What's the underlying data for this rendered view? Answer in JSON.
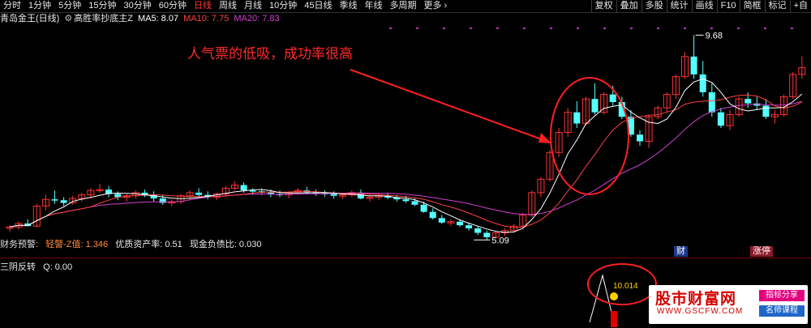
{
  "toolbar": {
    "periods": [
      "分时",
      "1分钟",
      "5分钟",
      "15分钟",
      "30分钟",
      "60分钟",
      "日线",
      "周线",
      "月线",
      "10分钟",
      "45日线",
      "季线",
      "年线",
      "多周期",
      "更多 ›"
    ],
    "active_period": "日线",
    "tools": [
      "复权",
      "叠加",
      "多股",
      "统计",
      "画线",
      "F10",
      "简框",
      "标记",
      "+自"
    ]
  },
  "indicator_line": {
    "stock": "青岛金王(日线)",
    "formula": "高胜率抄底主Z",
    "ma5": "MA5: 8.07",
    "ma10": "MA10: 7.75",
    "ma20": "MA20: 7.83",
    "ma5_color": "#ffffff",
    "ma10_color": "#ff4040",
    "ma20_color": "#d040d0"
  },
  "annotation": "人气票的低吸，成功率很高",
  "price_labels": {
    "high": "9.68",
    "low": "5.09"
  },
  "financial_row": {
    "title": "财务预警:",
    "warning": "轻警-Z值: 1.346",
    "quality": "优质资产率: 0.51",
    "cash": "现金负债比: 0.030"
  },
  "tags": {
    "cai": "财",
    "zhangting": "涨停"
  },
  "sub_panel": {
    "title": "三阴反转",
    "q": "Q: 0.00",
    "signal_value": "10.014"
  },
  "watermark": {
    "main": "股市财富网",
    "url": "WWW.GSCFW.COM",
    "tag1": "指标分享",
    "tag2": "名师课程"
  },
  "colors": {
    "up": "#ff3232",
    "down": "#54ffff",
    "ma5": "#ffffff",
    "ma10": "#ff4040",
    "ma20": "#d040d0"
  },
  "chart_data": {
    "type": "candlestick",
    "candles": [
      [
        5.35,
        5.42,
        5.28,
        5.38
      ],
      [
        5.38,
        5.5,
        5.32,
        5.46
      ],
      [
        5.46,
        5.55,
        5.4,
        5.4
      ],
      [
        5.4,
        5.9,
        5.38,
        5.85
      ],
      [
        5.85,
        6.1,
        5.75,
        6.0
      ],
      [
        6.0,
        6.2,
        5.9,
        5.98
      ],
      [
        5.98,
        6.05,
        5.85,
        5.92
      ],
      [
        5.92,
        6.08,
        5.88,
        6.02
      ],
      [
        6.02,
        6.15,
        5.95,
        6.1
      ],
      [
        6.1,
        6.25,
        6.02,
        6.2
      ],
      [
        6.2,
        6.35,
        6.15,
        6.22
      ],
      [
        6.22,
        6.3,
        6.05,
        6.12
      ],
      [
        6.12,
        6.18,
        5.98,
        6.05
      ],
      [
        6.05,
        6.12,
        5.95,
        6.08
      ],
      [
        6.08,
        6.2,
        6.02,
        6.15
      ],
      [
        6.15,
        6.22,
        6.05,
        6.1
      ],
      [
        6.1,
        6.18,
        5.95,
        6.02
      ],
      [
        6.02,
        6.1,
        5.88,
        5.92
      ],
      [
        5.92,
        6.0,
        5.85,
        5.95
      ],
      [
        5.95,
        6.12,
        5.9,
        6.08
      ],
      [
        6.08,
        6.2,
        6.0,
        6.15
      ],
      [
        6.15,
        6.25,
        6.05,
        6.1
      ],
      [
        6.1,
        6.18,
        6.0,
        6.05
      ],
      [
        6.05,
        6.15,
        5.98,
        6.12
      ],
      [
        6.12,
        6.3,
        6.08,
        6.25
      ],
      [
        6.25,
        6.4,
        6.2,
        6.32
      ],
      [
        6.32,
        6.38,
        6.15,
        6.2
      ],
      [
        6.2,
        6.25,
        6.1,
        6.18
      ],
      [
        6.18,
        6.24,
        6.1,
        6.15
      ],
      [
        6.15,
        6.22,
        6.05,
        6.12
      ],
      [
        6.12,
        6.2,
        6.05,
        6.1
      ],
      [
        6.1,
        6.18,
        6.02,
        6.15
      ],
      [
        6.15,
        6.25,
        6.1,
        6.2
      ],
      [
        6.2,
        6.28,
        6.12,
        6.16
      ],
      [
        6.16,
        6.22,
        6.08,
        6.14
      ],
      [
        6.14,
        6.2,
        6.06,
        6.12
      ],
      [
        6.12,
        6.18,
        6.02,
        6.08
      ],
      [
        6.08,
        6.15,
        6.0,
        6.1
      ],
      [
        6.1,
        6.2,
        6.05,
        6.15
      ],
      [
        6.15,
        6.22,
        6.0,
        6.02
      ],
      [
        6.02,
        6.1,
        5.95,
        6.05
      ],
      [
        6.05,
        6.12,
        5.98,
        6.08
      ],
      [
        6.08,
        6.15,
        6.0,
        6.04
      ],
      [
        6.04,
        6.1,
        5.95,
        6.0
      ],
      [
        6.0,
        6.08,
        5.92,
        5.96
      ],
      [
        5.96,
        6.02,
        5.85,
        5.88
      ],
      [
        5.88,
        5.95,
        5.7,
        5.72
      ],
      [
        5.72,
        5.8,
        5.55,
        5.58
      ],
      [
        5.58,
        5.65,
        5.45,
        5.48
      ],
      [
        5.48,
        5.55,
        5.4,
        5.5
      ],
      [
        5.5,
        5.55,
        5.38,
        5.42
      ],
      [
        5.42,
        5.48,
        5.3,
        5.35
      ],
      [
        5.35,
        5.4,
        5.2,
        5.25
      ],
      [
        5.25,
        5.3,
        5.09,
        5.15
      ],
      [
        5.15,
        5.28,
        5.12,
        5.25
      ],
      [
        5.25,
        5.35,
        5.18,
        5.3
      ],
      [
        5.3,
        5.45,
        5.25,
        5.4
      ],
      [
        5.4,
        5.7,
        5.38,
        5.65
      ],
      [
        5.65,
        6.2,
        5.6,
        6.15
      ],
      [
        6.15,
        6.5,
        6.05,
        6.45
      ],
      [
        6.45,
        7.1,
        6.4,
        7.05
      ],
      [
        7.05,
        7.6,
        6.95,
        7.5
      ],
      [
        7.5,
        8.05,
        7.4,
        7.95
      ],
      [
        7.95,
        8.2,
        7.6,
        7.7
      ],
      [
        7.7,
        8.3,
        7.65,
        8.25
      ],
      [
        8.25,
        8.6,
        7.9,
        7.95
      ],
      [
        7.95,
        8.4,
        7.9,
        8.35
      ],
      [
        8.35,
        8.55,
        8.1,
        8.18
      ],
      [
        8.18,
        8.3,
        7.8,
        7.85
      ],
      [
        7.85,
        8.0,
        7.4,
        7.45
      ],
      [
        7.45,
        7.55,
        7.2,
        7.3
      ],
      [
        7.3,
        7.9,
        7.15,
        7.85
      ],
      [
        7.85,
        8.1,
        7.8,
        8.05
      ],
      [
        8.05,
        8.4,
        7.95,
        8.35
      ],
      [
        8.35,
        8.8,
        8.25,
        8.75
      ],
      [
        8.75,
        9.3,
        8.7,
        9.2
      ],
      [
        9.2,
        9.68,
        8.7,
        8.8
      ],
      [
        8.8,
        9.1,
        8.3,
        8.4
      ],
      [
        8.4,
        8.6,
        7.85,
        7.95
      ],
      [
        7.95,
        8.05,
        7.6,
        7.65
      ],
      [
        7.65,
        8.0,
        7.55,
        7.9
      ],
      [
        7.9,
        8.3,
        7.85,
        8.25
      ],
      [
        8.25,
        8.4,
        8.05,
        8.15
      ],
      [
        8.15,
        8.3,
        8.0,
        8.1
      ],
      [
        8.1,
        8.25,
        7.8,
        7.85
      ],
      [
        7.85,
        8.0,
        7.7,
        7.9
      ],
      [
        7.9,
        8.35,
        7.85,
        8.3
      ],
      [
        8.3,
        8.85,
        8.25,
        8.8
      ],
      [
        8.8,
        9.2,
        8.7,
        8.95
      ]
    ],
    "ylim": [
      4.95,
      9.85
    ]
  }
}
